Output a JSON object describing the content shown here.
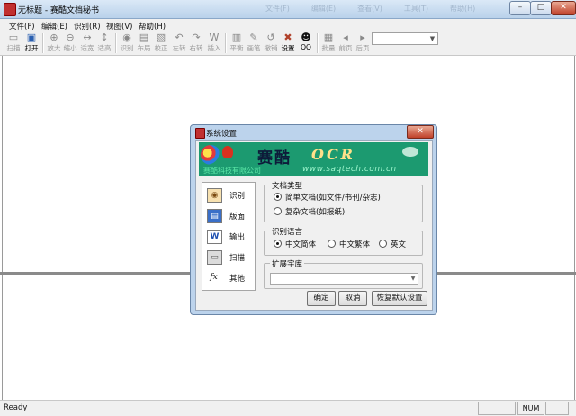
{
  "window": {
    "title": "无标题 - 赛酷文档秘书",
    "ghost_menu": [
      "文件(F)",
      "编辑(E)",
      "查看(V)",
      "工具(T)",
      "帮助(H)"
    ],
    "controls": {
      "minimize": "–",
      "maximize": "□",
      "close": "✕"
    }
  },
  "menu": [
    "文件(F)",
    "编辑(E)",
    "识别(R)",
    "视图(V)",
    "帮助(H)"
  ],
  "toolbar": {
    "buttons": [
      {
        "label": "扫描",
        "icon": "scanner-icon",
        "glyph": "▭"
      },
      {
        "label": "打开",
        "icon": "open-folder-icon",
        "glyph": "▣"
      },
      {
        "label": "放大",
        "icon": "zoom-in-icon",
        "glyph": "⊕"
      },
      {
        "label": "缩小",
        "icon": "zoom-out-icon",
        "glyph": "⊖"
      },
      {
        "label": "适宽",
        "icon": "fit-width-icon",
        "glyph": "↔"
      },
      {
        "label": "适高",
        "icon": "fit-height-icon",
        "glyph": "↕"
      },
      {
        "label": "识别",
        "icon": "recognize-icon",
        "glyph": "◉"
      },
      {
        "label": "布局",
        "icon": "layout-icon",
        "glyph": "▤"
      },
      {
        "label": "校正",
        "icon": "correct-icon",
        "glyph": "▧"
      },
      {
        "label": "左转",
        "icon": "rotate-left-icon",
        "glyph": "↶"
      },
      {
        "label": "右转",
        "icon": "rotate-right-icon",
        "glyph": "↷"
      },
      {
        "label": "插入",
        "icon": "insert-word-icon",
        "glyph": "W"
      },
      {
        "label": "平衡",
        "icon": "balance-icon",
        "glyph": "▥"
      },
      {
        "label": "画笔",
        "icon": "pen-icon",
        "glyph": "✎"
      },
      {
        "label": "撤销",
        "icon": "undo-icon",
        "glyph": "↺"
      },
      {
        "label": "设置",
        "icon": "settings-tools-icon",
        "glyph": "✖"
      },
      {
        "label": "QQ",
        "icon": "qq-penguin-icon",
        "glyph": "☻"
      },
      {
        "label": "批量",
        "icon": "batch-icon",
        "glyph": "▦"
      },
      {
        "label": "前页",
        "icon": "prev-page-icon",
        "glyph": "◂"
      },
      {
        "label": "后页",
        "icon": "next-page-icon",
        "glyph": "▸"
      }
    ]
  },
  "status": {
    "text": "Ready",
    "caps": "",
    "num": "NUM",
    "scrl": ""
  },
  "dialog": {
    "title": "系统设置",
    "close": "✕",
    "banner": {
      "cn": "赛酷",
      "en": "OCR",
      "company": "赛酷科技有限公司",
      "url": "www.saqtech.com.cn"
    },
    "nav": [
      {
        "label": "识别",
        "icon": "eye-icon",
        "glyph": "◉"
      },
      {
        "label": "版面",
        "icon": "layout-page-icon",
        "glyph": "▤"
      },
      {
        "label": "输出",
        "icon": "word-document-icon",
        "glyph": "W"
      },
      {
        "label": "扫描",
        "icon": "scanner-icon",
        "glyph": "▭"
      },
      {
        "label": "其他",
        "icon": "function-fx-icon",
        "glyph": "fx"
      }
    ],
    "doc_type": {
      "legend": "文档类型",
      "options": [
        "简单文档(如文件/书刊/杂志)",
        "复杂文档(如报纸)"
      ],
      "selected": 0
    },
    "language": {
      "legend": "识别语言",
      "options": [
        "中文简体",
        "中文繁体",
        "英文"
      ],
      "selected": 0
    },
    "library": {
      "legend": "扩展字库",
      "value": ""
    },
    "buttons": {
      "ok": "确定",
      "cancel": "取消",
      "restore": "恢复默认设置"
    }
  },
  "colors": {
    "title_bar": "#c8dcf1",
    "banner_bg": "#1c9a70",
    "dialog_frame": "#bcd3ec"
  }
}
